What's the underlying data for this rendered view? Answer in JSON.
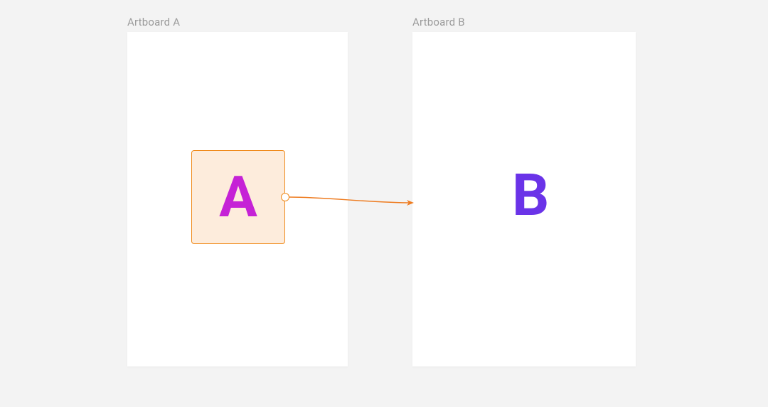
{
  "artboards": {
    "a": {
      "label": "Artboard A",
      "element_letter": "A"
    },
    "b": {
      "label": "Artboard B",
      "element_letter": "B"
    }
  },
  "colors": {
    "canvas_bg": "#f3f3f3",
    "artboard_bg": "#ffffff",
    "label_text": "#9a9a9a",
    "selection_border": "#f08a1a",
    "selection_fill": "#fdecdc",
    "letter_a": "#c522d6",
    "letter_b": "#6a33e8",
    "connector": "#ee7b1f"
  }
}
